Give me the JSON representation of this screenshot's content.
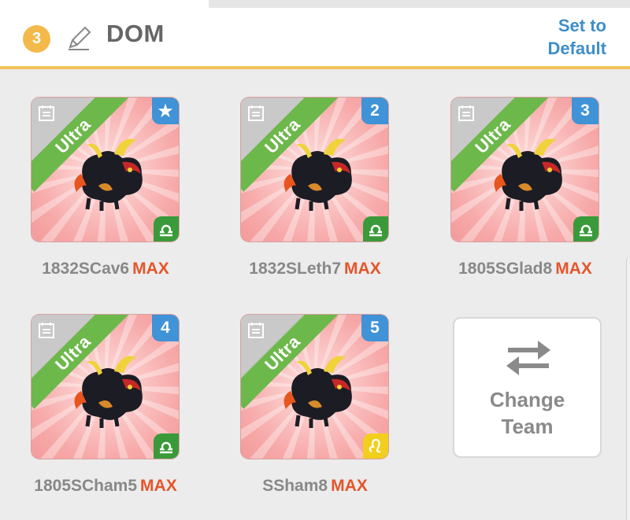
{
  "header": {
    "team_number": "3",
    "team_name": "DOM",
    "set_default_label": "Set to Default"
  },
  "cards": [
    {
      "rarity": "Ultra",
      "slot_badge": "★",
      "sign": "libra",
      "name": "1832SCav6",
      "level": "MAX"
    },
    {
      "rarity": "Ultra",
      "slot_badge": "2",
      "sign": "libra",
      "name": "1832SLeth7",
      "level": "MAX"
    },
    {
      "rarity": "Ultra",
      "slot_badge": "3",
      "sign": "libra",
      "name": "1805SGlad8",
      "level": "MAX"
    },
    {
      "rarity": "Ultra",
      "slot_badge": "4",
      "sign": "libra",
      "name": "1805SCham5",
      "level": "MAX"
    },
    {
      "rarity": "Ultra",
      "slot_badge": "5",
      "sign": "leo",
      "name": "SSham8",
      "level": "MAX"
    }
  ],
  "change_team": {
    "label": "Change Team"
  },
  "colors": {
    "accent_orange": "#f3b94b",
    "link_blue": "#3f8ec9",
    "max_red": "#e3562b",
    "ultra_green": "#6db84b",
    "slot_blue": "#3f93d6",
    "libra_green": "#3a9a3a",
    "leo_yellow": "#f2cf1d"
  }
}
